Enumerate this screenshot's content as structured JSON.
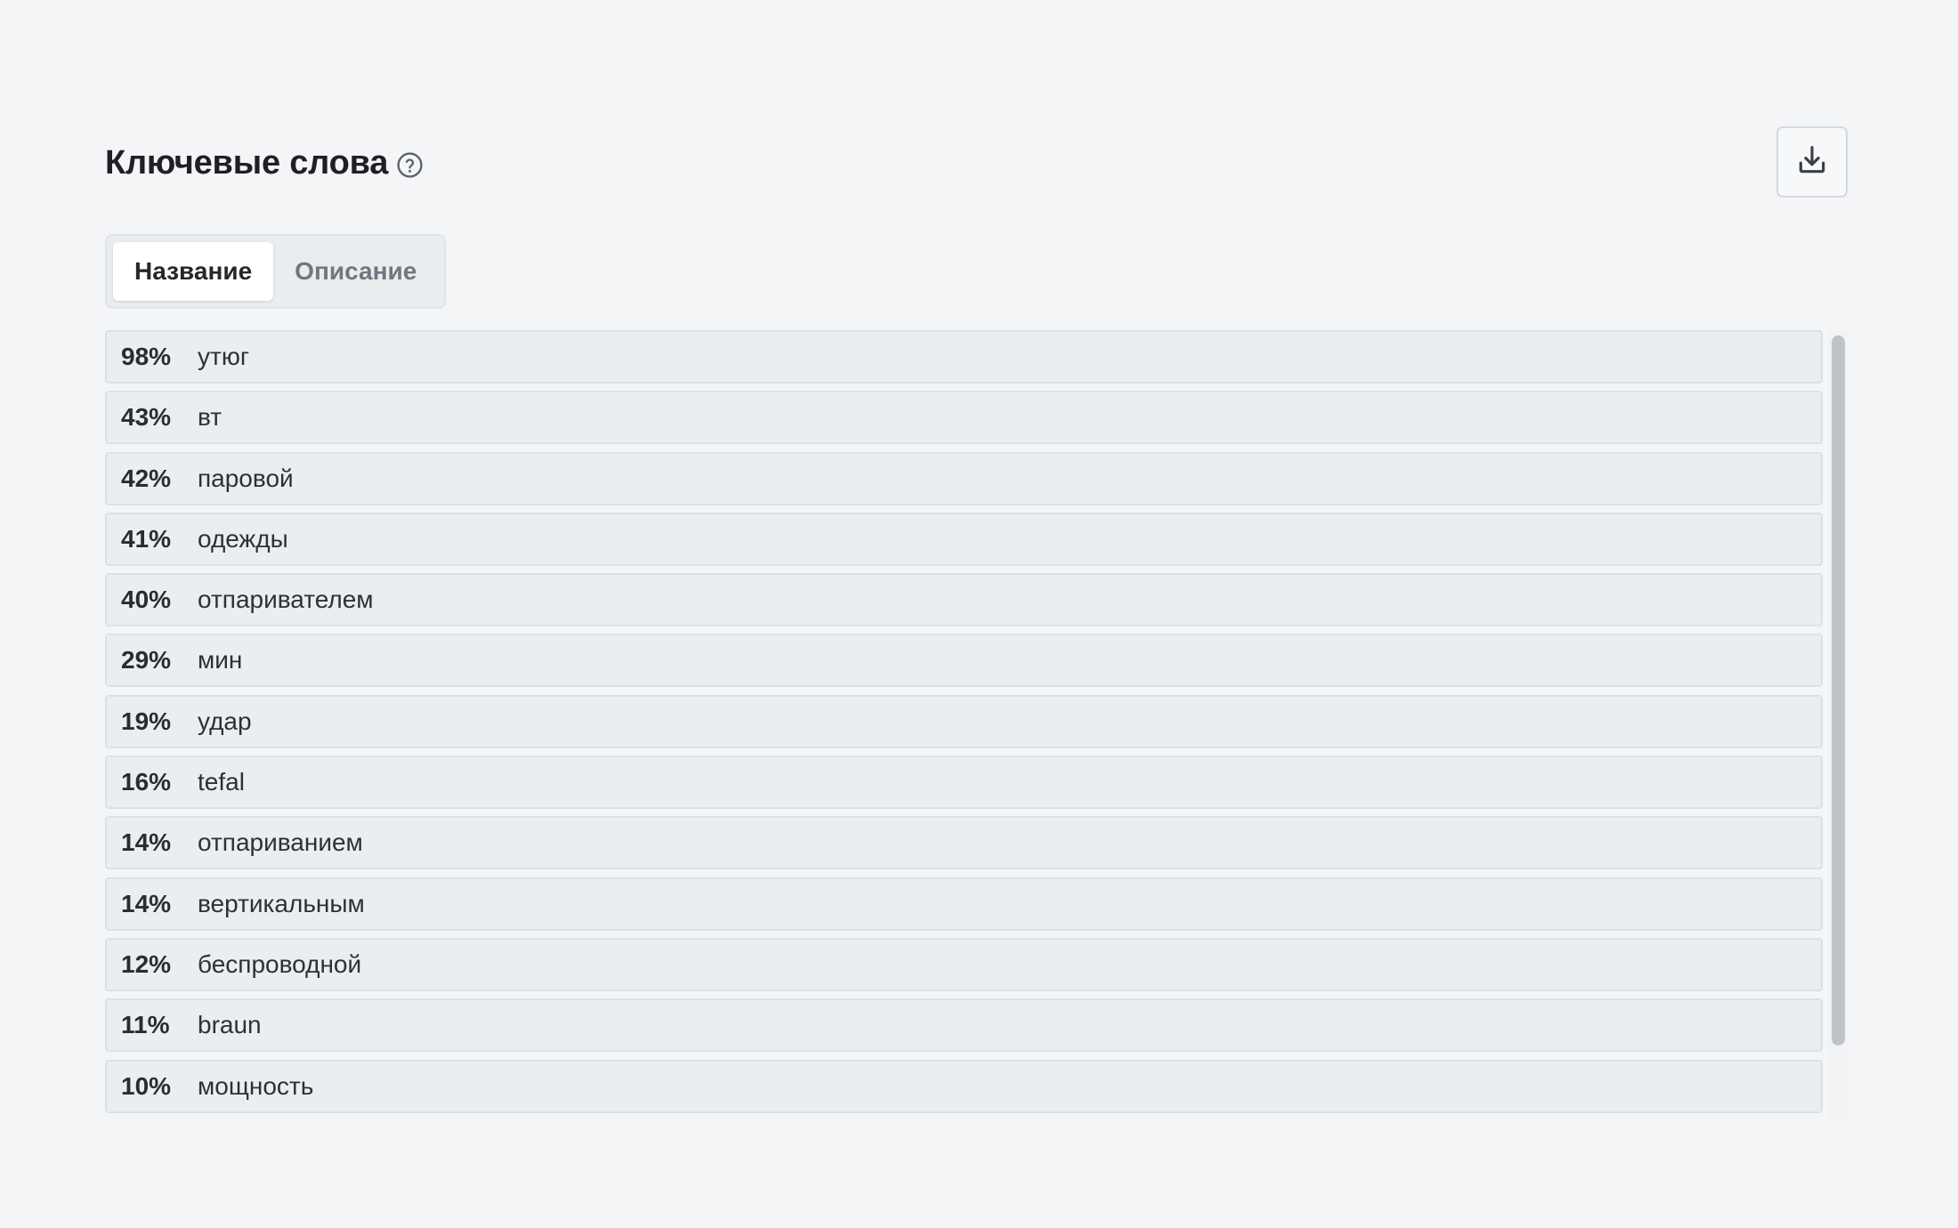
{
  "header": {
    "title": "Ключевые слова",
    "help_icon": "help-circle-icon",
    "download_icon": "download-icon"
  },
  "tabs": [
    {
      "label": "Название",
      "active": true
    },
    {
      "label": "Описание",
      "active": false
    }
  ],
  "keywords": [
    {
      "percent": "98%",
      "word": "утюг"
    },
    {
      "percent": "43%",
      "word": "вт"
    },
    {
      "percent": "42%",
      "word": "паровой"
    },
    {
      "percent": "41%",
      "word": "одежды"
    },
    {
      "percent": "40%",
      "word": "отпаривателем"
    },
    {
      "percent": "29%",
      "word": "мин"
    },
    {
      "percent": "19%",
      "word": "удар"
    },
    {
      "percent": "16%",
      "word": "tefal"
    },
    {
      "percent": "14%",
      "word": "отпариванием"
    },
    {
      "percent": "14%",
      "word": "вертикальным"
    },
    {
      "percent": "12%",
      "word": "беспроводной"
    },
    {
      "percent": "11%",
      "word": "braun"
    },
    {
      "percent": "10%",
      "word": "мощность"
    }
  ],
  "colors": {
    "background": "#f4f5f7",
    "row_bg": "#ebeef1",
    "active_tab_bg": "#ffffff",
    "inactive_tab_text": "#6f7781"
  }
}
